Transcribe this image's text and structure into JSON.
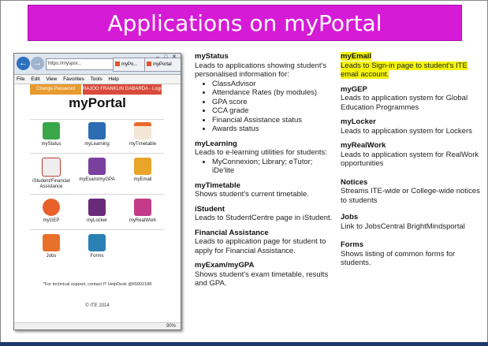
{
  "banner": {
    "title": "Applications on myPortal"
  },
  "browser": {
    "address": "https://myspor...",
    "tab1": "myPo...",
    "tab2": "myPortal",
    "menu": [
      "File",
      "Edit",
      "View",
      "Favorites",
      "Tools",
      "Help"
    ],
    "change_password": "Change Password",
    "logout": "RAJOO FRANKLIN GABARDA - Logout",
    "portal_title": "myPortal",
    "apps": [
      {
        "label": "myStatus",
        "color": "#3aa64a"
      },
      {
        "label": "myLearning",
        "color": "#2b6cb3"
      },
      {
        "label": "myTimetable",
        "color": "#e86a2a"
      },
      {
        "label": "iStudent/Financial Assistance",
        "color": "#c0392b"
      },
      {
        "label": "myExam/myGPA",
        "color": "#7b3fa0"
      },
      {
        "label": "myEmail",
        "color": "#e8a52a"
      },
      {
        "label": "myGEP",
        "color": "#e8602a"
      },
      {
        "label": "myLocker",
        "color": "#6a2a7a"
      },
      {
        "label": "myRealWork",
        "color": "#c23b8a"
      },
      {
        "label": "Jobs",
        "color": "#e8702a"
      },
      {
        "label": "Forms",
        "color": "#2a7fb3"
      }
    ],
    "footnote": "*For technical support, contact IT HelpDesk @65902188",
    "copyright": "© ITE 2014",
    "zoom": "90%"
  },
  "left_column": [
    {
      "title": "myStatus",
      "desc": "Leads to applications showing student's personalised information for:",
      "bullets": [
        "ClassAdvisor",
        "Attendance Rates (by modules)",
        "GPA score",
        "CCA grade",
        "Financial Assistance status",
        "Awards status"
      ]
    },
    {
      "title": "myLearning",
      "desc": "Leads to e-learning utilities for students:",
      "bullets": [
        "MyConnexion; Library; eTutor; iDe'lite"
      ]
    },
    {
      "title": "myTimetable",
      "desc": "Shows student's current timetable."
    },
    {
      "title": "iStudent",
      "desc": "Leads to StudentCentre page in iStudent."
    },
    {
      "title": "Financial Assistance",
      "desc": "Leads to application page for student to apply for Financial Assistance."
    },
    {
      "title": "myExam/myGPA",
      "desc": "Shows student's exam timetable, results and GPA."
    }
  ],
  "right_column": [
    {
      "title": "myEmail",
      "desc1": "Leads to Sign-in page to student's ITE",
      "desc2": "email account."
    },
    {
      "title": "myGEP",
      "desc1": "Leads to application system for Global",
      "desc2": "Education Programmes"
    },
    {
      "title": "myLocker",
      "desc1": "Leads to application system for Lockers",
      "desc2": ""
    },
    {
      "title": "myRealWork",
      "desc1": "Leads to application system for RealWork",
      "desc2": "opportunities"
    },
    {
      "title": "Notices",
      "desc1": "Streams ITE-wide or College-wide notices",
      "desc2": "to students"
    },
    {
      "title": "Jobs",
      "desc1": "Link to JobsCentral BrightMindsportal",
      "desc2": ""
    },
    {
      "title": "Forms",
      "desc1": "Shows listing of common forms for",
      "desc2": "students."
    }
  ]
}
